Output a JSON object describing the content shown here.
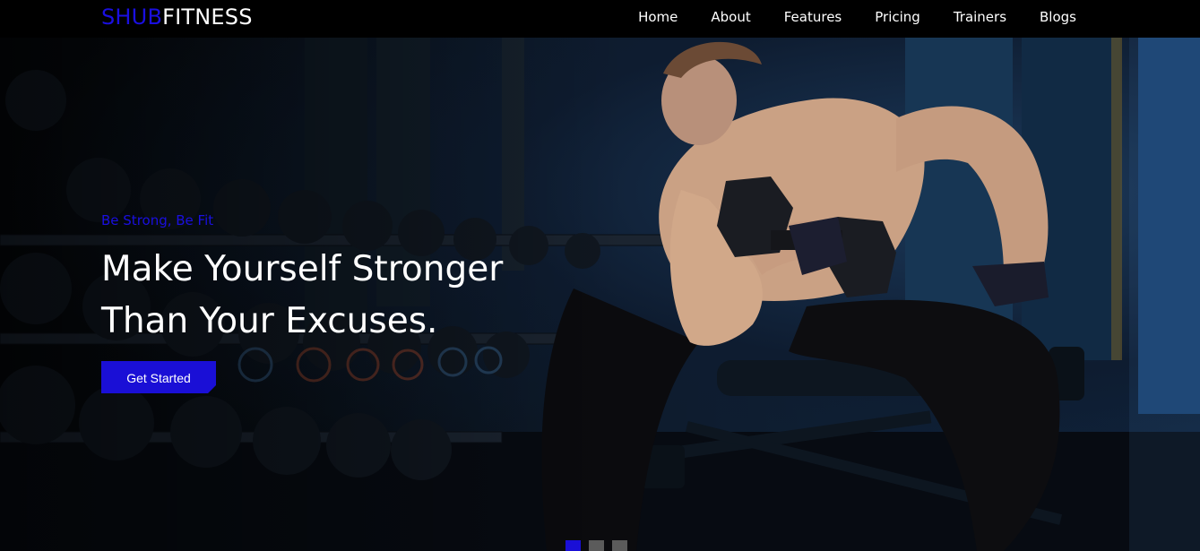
{
  "brand": {
    "part1": "SHUB",
    "part2": "FITNESS",
    "accent_color": "#1a0fe0"
  },
  "nav": {
    "items": [
      {
        "label": "Home"
      },
      {
        "label": "About"
      },
      {
        "label": "Features"
      },
      {
        "label": "Pricing"
      },
      {
        "label": "Trainers"
      },
      {
        "label": "Blogs"
      }
    ]
  },
  "hero": {
    "tagline": "Be Strong, Be Fit",
    "title_line1": "Make Yourself Stronger",
    "title_line2": "Than Your Excuses.",
    "cta_label": "Get Started",
    "background_image": "man-lifting-dumbbell-in-gym"
  },
  "slider": {
    "count": 3,
    "active_index": 0
  }
}
